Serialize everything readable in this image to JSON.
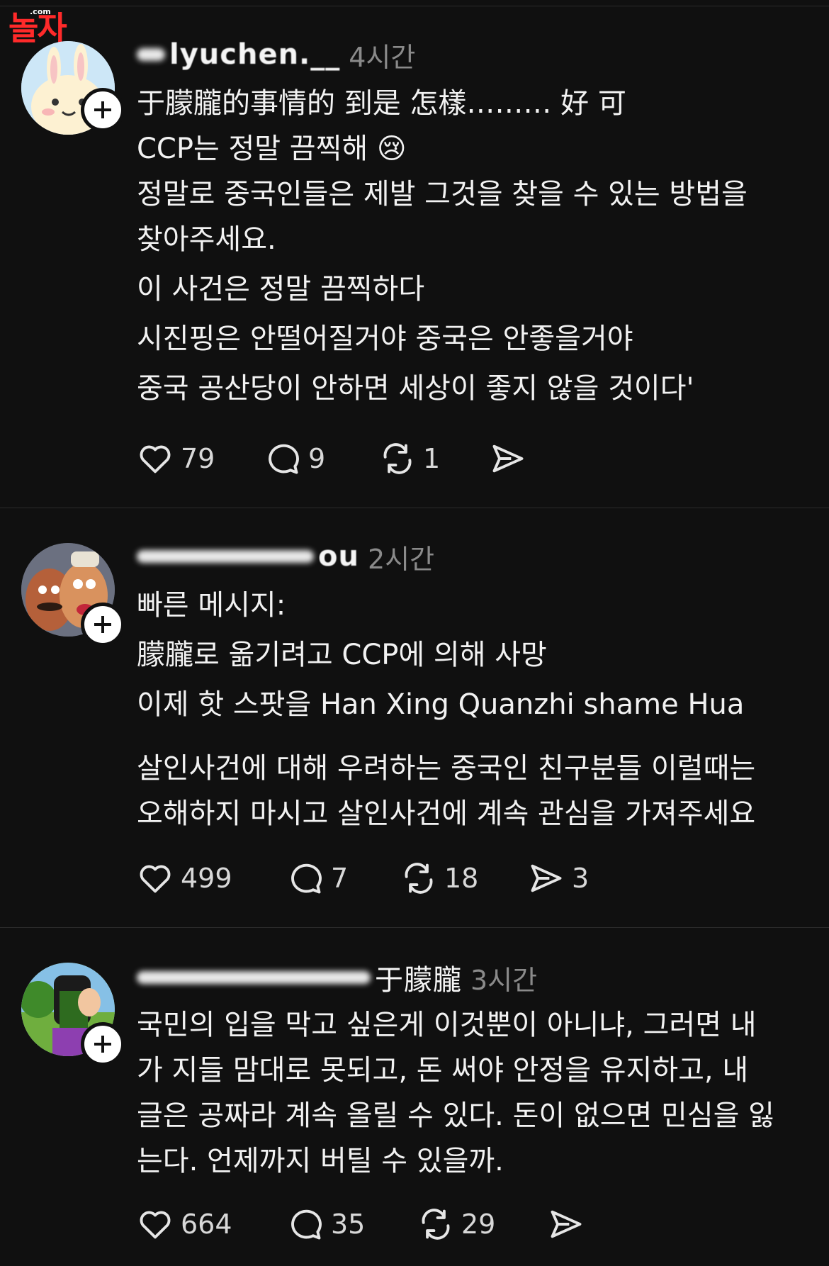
{
  "watermark": {
    "brand": "놀자",
    "dotcom": ".com"
  },
  "posts": [
    {
      "username": "lyuchen.__",
      "time": "4시간",
      "lines": [
        "于朦朧的事情的 到是 怎樣……… 好 可",
        "CCP는 정말 끔찍해 😢",
        "정말로 중국인들은 제발 그것을 찾을 수 있는 방법을",
        "찾아주세요.",
        "이 사건은 정말 끔찍하다",
        "시진핑은 안떨어질거야 중국은 안좋을거야",
        "중국 공산당이 안하면 세상이 좋지 않을 것이다'"
      ],
      "likes": "79",
      "comments": "9",
      "reposts": "1",
      "shares": ""
    },
    {
      "username": "ou",
      "time": "2시간",
      "lines": [
        "빠른 메시지:",
        "朦朧로 옮기려고 CCP에 의해 사망",
        "이제 핫 스팟을 Han Xing Quanzhi shame Hua"
      ],
      "lines2": [
        "살인사건에 대해 우려하는 중국인 친구분들 이럴때는",
        "오해하지 마시고 살인사건에 계속 관심을 가져주세요"
      ],
      "likes": "499",
      "comments": "7",
      "reposts": "18",
      "shares": "3"
    },
    {
      "username": "于朦朧",
      "time": "3시간",
      "lines": [
        "국민의 입을 막고 싶은게 이것뿐이 아니냐, 그러면 내",
        "가 지들 맘대로 못되고, 돈 써야 안정을 유지하고, 내",
        "글은 공짜라 계속 올릴 수 있다. 돈이 없으면 민심을 잃",
        "는다. 언제까지 버틸 수 있을까."
      ],
      "likes": "664",
      "comments": "35",
      "reposts": "29",
      "shares": ""
    }
  ]
}
